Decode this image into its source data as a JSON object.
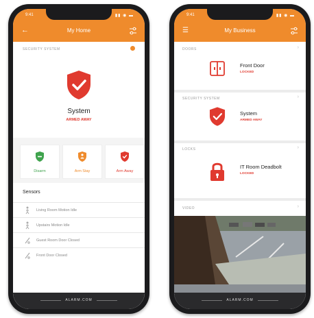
{
  "colors": {
    "accent": "#ef8b2c",
    "armed": "#e03a2f",
    "disarm": "#3fa34d",
    "stay": "#ef8b2c"
  },
  "left_phone": {
    "status_time": "9:41",
    "status_icons": "▮▮ ◉ ▬",
    "nav_icon": "back-arrow-icon",
    "title": "My Home",
    "section_label": "SECURITY SYSTEM",
    "system": {
      "name": "System",
      "status": "ARMED AWAY"
    },
    "arm_buttons": [
      {
        "label": "Disarm",
        "icon": "shield-minus-icon",
        "color": "#3fa34d"
      },
      {
        "label": "Arm Stay",
        "icon": "shield-person-icon",
        "color": "#ef8b2c"
      },
      {
        "label": "Arm Away",
        "icon": "shield-check-icon",
        "color": "#e03a2f"
      }
    ],
    "sensors_title": "Sensors",
    "sensors": [
      {
        "label": "Living Room Motion Idle",
        "icon": "motion-sensor-icon"
      },
      {
        "label": "Upstairs Motion Idle",
        "icon": "motion-sensor-icon"
      },
      {
        "label": "Guest Room Door Closed",
        "icon": "door-sensor-icon"
      },
      {
        "label": "Front Door Closed",
        "icon": "door-sensor-icon"
      }
    ],
    "footer_logo": "ALARM.COM"
  },
  "right_phone": {
    "status_time": "9:41",
    "status_icons": "▮▮ ◉ ▬",
    "nav_icon": "menu-icon",
    "title": "My Business",
    "doors": {
      "label": "DOORS",
      "name": "Front Door",
      "status": "LOCKED"
    },
    "security": {
      "label": "SECURITY SYSTEM",
      "name": "System",
      "status": "ARMED AWAY"
    },
    "locks": {
      "label": "LOCKS",
      "name": "IT Room Deadbolt",
      "status": "LOCKED"
    },
    "video": {
      "label": "VIDEO"
    },
    "footer_logo": "ALARM.COM"
  }
}
